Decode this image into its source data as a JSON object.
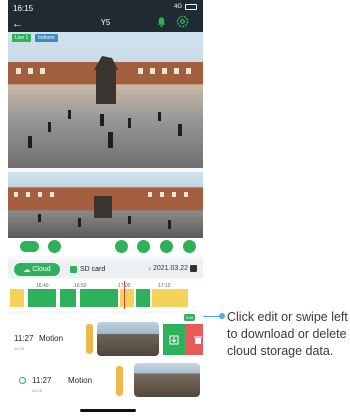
{
  "status_bar": {
    "time": "16:15",
    "signal": "4G"
  },
  "header": {
    "title": "Y5"
  },
  "video": {
    "badge_live": "Live 1",
    "badge_indoor": "Indoors"
  },
  "controls": [
    "battery-icon",
    "wifi-icon",
    "shortcut-icon",
    "shortcut-icon",
    "shortcut-icon",
    "chevron-down-icon"
  ],
  "tabs": {
    "cloud": "Cloud",
    "sd_card": "SD card",
    "date": "2021.03.22"
  },
  "timeline": {
    "ticks": [
      "16:40",
      "16:50",
      "17:00",
      "17:10"
    ]
  },
  "recordings": [
    {
      "time": "11:27",
      "sub": "06:28",
      "type": "Motion"
    },
    {
      "time": "11:27",
      "sub": "06:28",
      "type": "Motion"
    }
  ],
  "edit_tag": "Edit",
  "caption": "Click edit or swipe left to download or delete cloud storage data.",
  "colors": {
    "accent_green": "#2fb15b",
    "delete_red": "#e85a5a",
    "callout_blue": "#49b0e3",
    "play_orange": "#f3b64b"
  }
}
